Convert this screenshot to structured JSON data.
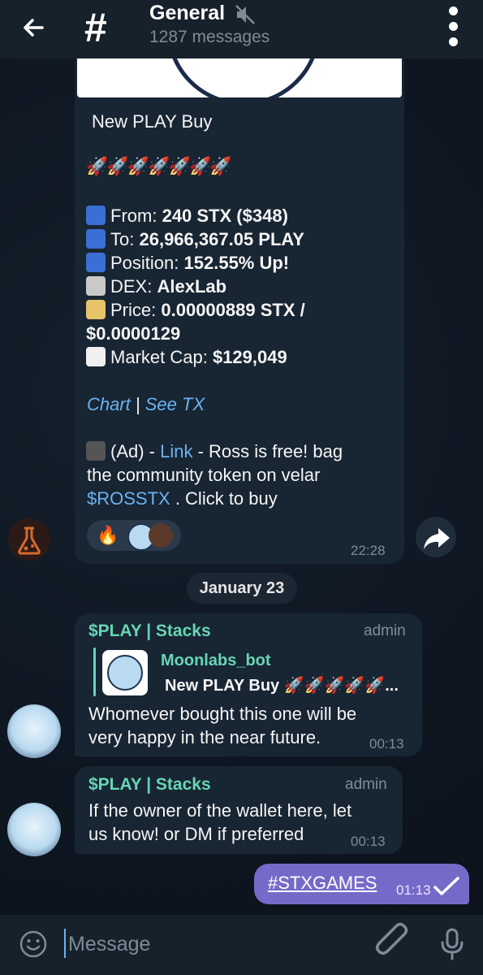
{
  "header": {
    "title": "General",
    "subtitle": "1287 messages"
  },
  "bot_post": {
    "heading": "New PLAY Buy",
    "rockets": "🚀🚀🚀🚀🚀🚀🚀",
    "lines": {
      "from_label": "From:",
      "from_value": "240 STX  ($348)",
      "to_label": "To:",
      "to_value": "26,966,367.05 PLAY",
      "position_label": "Position:",
      "position_value": "152.55% Up!",
      "dex_label": "DEX:",
      "dex_value": "AlexLab",
      "price_label": "Price:",
      "price_value": "0.00000889 STX  /",
      "price_value2": "$0.0000129",
      "mcap_label": "Market Cap:",
      "mcap_value": "$129,049"
    },
    "chart_link": "Chart",
    "separator": " | ",
    "tx_link": "See TX",
    "ad_prefix": "(Ad) - ",
    "ad_link": "Link",
    "ad_text1": " - Ross is free! bag",
    "ad_text2": "the community token on velar",
    "ad_token": "$ROSSTX",
    "ad_text3": " . Click to buy",
    "reaction_emoji": "🔥",
    "time": "22:28"
  },
  "date_divider": "January 23",
  "messages": [
    {
      "sender": "$PLAY | Stacks",
      "role": "admin",
      "quote_author": "Moonlabs_bot",
      "quote_text": "New PLAY Buy 🚀🚀🚀🚀🚀...",
      "text1": "Whomever bought this one will be",
      "text2": "very happy in the near future.",
      "time": "00:13"
    },
    {
      "sender": "$PLAY | Stacks",
      "role": "admin",
      "text1": "If the owner of the wallet here, let",
      "text2": "us know! or DM if preferred",
      "time": "00:13"
    }
  ],
  "own_message": {
    "text": "#STXGAMES",
    "time": "01:13"
  },
  "composer": {
    "placeholder": "Message"
  },
  "colors": {
    "background": "#0e1621",
    "bubble": "#182533",
    "accent": "#6ab3f3",
    "sender": "#67d5b5",
    "own_bubble": "#766ac8"
  }
}
